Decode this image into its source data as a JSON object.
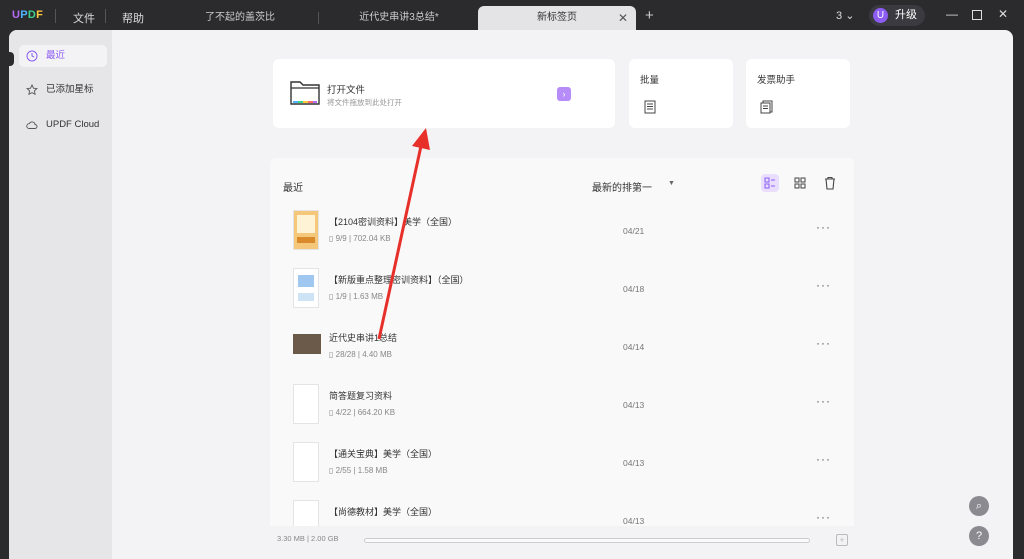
{
  "app": {
    "logo": {
      "u": "U",
      "p": "P",
      "d": "D",
      "f": "F"
    },
    "menu": {
      "file": "文件",
      "help": "帮助"
    },
    "tabs": [
      {
        "label": "了不起的盖茨比"
      },
      {
        "label": "近代史串讲3总结*"
      },
      {
        "label": "新标签页"
      }
    ],
    "tab_count": "3",
    "upgrade": {
      "avatar": "U",
      "label": "升级"
    }
  },
  "sidebar": {
    "items": [
      {
        "label": "最近",
        "icon": "clock-icon"
      },
      {
        "label": "已添加星标",
        "icon": "star-icon"
      },
      {
        "label": "UPDF Cloud",
        "icon": "cloud-icon"
      }
    ]
  },
  "open_file": {
    "title": "打开文件",
    "subtitle": "将文件拖放到此处打开",
    "arrow": "›"
  },
  "batch": {
    "title": "批量"
  },
  "invoice": {
    "title": "发票助手"
  },
  "recent": {
    "title": "最近",
    "sort_label": "最新的排第一",
    "files": [
      {
        "name": "【2104密训资料】美学（全国）",
        "pages": "9/9",
        "size": "702.04 KB",
        "date": "04/21"
      },
      {
        "name": "【新版重点整理密训资料】（全国）",
        "pages": "1/9",
        "size": "1.63 MB",
        "date": "04/18"
      },
      {
        "name": "近代史串讲1总结",
        "pages": "28/28",
        "size": "4.40 MB",
        "date": "04/14"
      },
      {
        "name": "简答题复习资料",
        "pages": "4/22",
        "size": "664.20 KB",
        "date": "04/13"
      },
      {
        "name": "【通关宝典】美学（全国）",
        "pages": "2/55",
        "size": "1.58 MB",
        "date": "04/13"
      },
      {
        "name": "【尚德教材】美学（全国）",
        "pages": "",
        "size": "",
        "date": "04/13"
      }
    ],
    "more_label": "···"
  },
  "footer": {
    "storage": "3.30 MB | 2.00 GB"
  },
  "colors": {
    "accent": "#8c5cf5",
    "annotation_arrow": "#e8302a"
  }
}
